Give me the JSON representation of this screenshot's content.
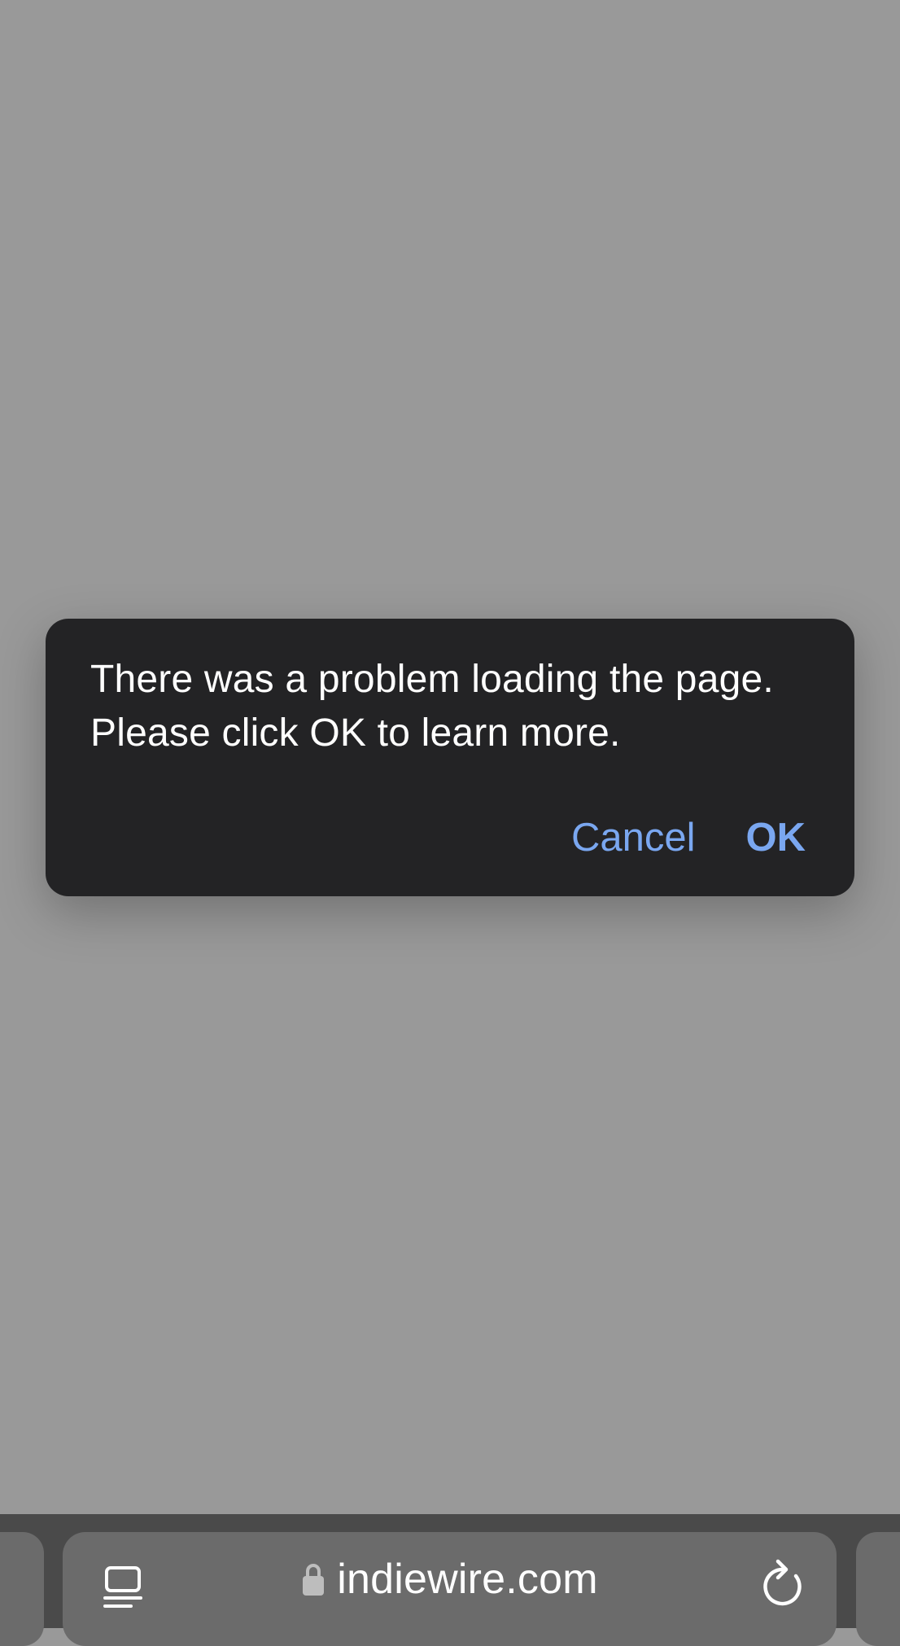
{
  "dialog": {
    "message": "There was a problem loading the page. Please click OK to learn more.",
    "cancel_label": "Cancel",
    "ok_label": "OK"
  },
  "toolbar": {
    "url": "indiewire.com",
    "tabs_icon": "tab-overview-icon",
    "lock_icon": "lock-icon",
    "reload_icon": "reload-icon"
  },
  "colors": {
    "dialog_bg": "#232325",
    "accent": "#7aa7f0",
    "page_dim": "#999999",
    "toolbar_bg": "#4a4a4a",
    "address_bar_bg": "#6b6b6b"
  }
}
